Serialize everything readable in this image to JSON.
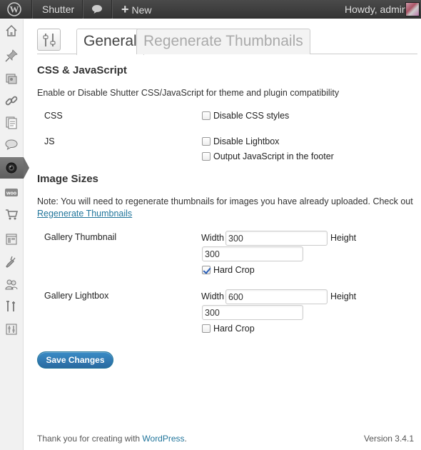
{
  "admin_bar": {
    "site_name": "Shutter",
    "new_label": "New",
    "howdy": "Howdy, admin"
  },
  "sidebar": {
    "icons": [
      "dashboard-icon",
      "pin-icon",
      "media-icon",
      "links-icon",
      "pages-icon",
      "comments-icon",
      "shutter-icon",
      "woo-icon",
      "cart-icon",
      "appearance-icon",
      "plugins-icon",
      "users-icon",
      "tools-icon",
      "settings-icon"
    ]
  },
  "tabs": [
    {
      "label": "General"
    },
    {
      "label": "Regenerate Thumbnails"
    }
  ],
  "css_js": {
    "heading": "CSS & JavaScript",
    "description": "Enable or Disable Shutter CSS/JavaScript for theme and plugin compatibility",
    "css_label": "CSS",
    "css_option": "Disable CSS styles",
    "js_label": "JS",
    "js_option1": "Disable Lightbox",
    "js_option2": "Output JavaScript in the footer"
  },
  "image_sizes": {
    "heading": "Image Sizes",
    "note": "Note: You will need to regenerate thumbnails for images you have already uploaded. Check out",
    "note_link": "Regenerate Thumbnails",
    "gallery_thumbnail": {
      "label": "Gallery Thumbnail",
      "width_label": "Width",
      "width": "300",
      "height_label": "Height",
      "height": "300",
      "crop_label": "Hard Crop",
      "crop_checked": true
    },
    "gallery_lightbox": {
      "label": "Gallery Lightbox",
      "width_label": "Width",
      "width": "600",
      "height_label": "Height",
      "height": "300",
      "crop_label": "Hard Crop",
      "crop_checked": false
    }
  },
  "save_label": "Save Changes",
  "footer": {
    "thanks": "Thank you for creating with ",
    "wp": "WordPress",
    "period": ".",
    "version": "Version 3.4.1"
  },
  "colors": {
    "accent": "#21759b",
    "button": "#2a6aa0"
  }
}
